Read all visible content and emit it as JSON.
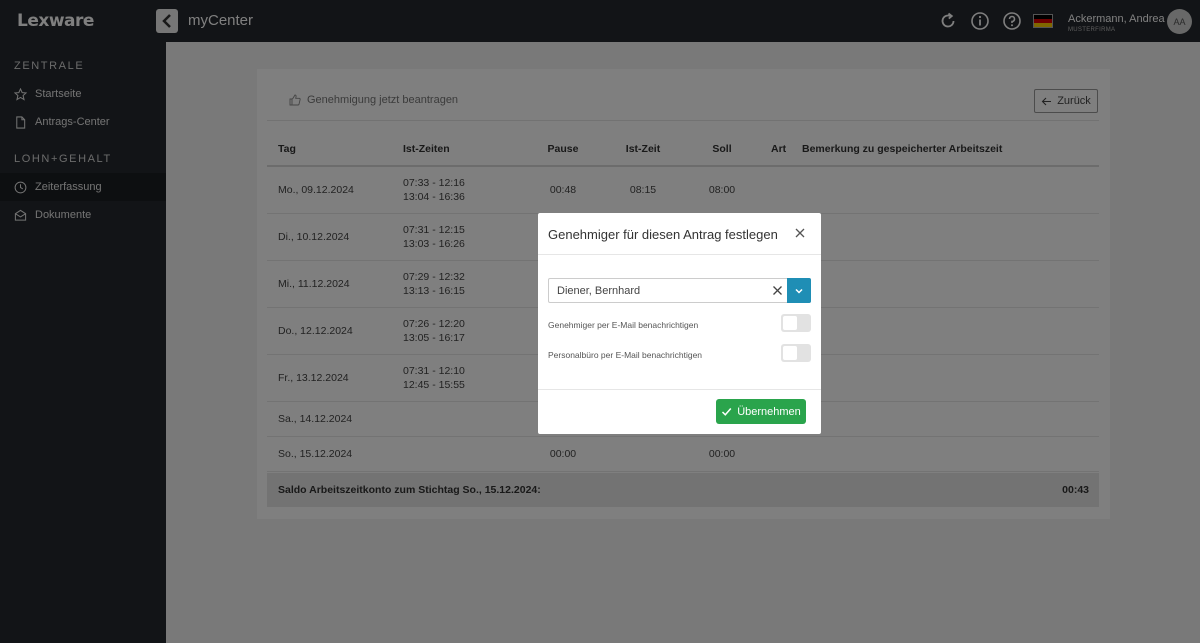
{
  "header": {
    "logo": "Lexware",
    "app_title": "myCenter",
    "user_name": "Ackermann, Andrea",
    "user_company": "MUSTERFIRMA",
    "avatar_initials": "AA"
  },
  "sidebar": {
    "section1": "ZENTRALE",
    "section2": "LOHN+GEHALT",
    "items": [
      {
        "label": "Startseite",
        "icon": "star-icon"
      },
      {
        "label": "Antrags-Center",
        "icon": "document-icon"
      },
      {
        "label": "Zeiterfassung",
        "icon": "clock-icon",
        "active": true
      },
      {
        "label": "Dokumente",
        "icon": "inbox-icon"
      }
    ]
  },
  "toolbar": {
    "request_label": "Genehmigung jetzt beantragen",
    "back_label": "Zurück"
  },
  "table": {
    "headers": [
      "Tag",
      "Ist-Zeiten",
      "Pause",
      "Ist-Zeit",
      "Soll",
      "Art",
      "Bemerkung zu gespeicherter Arbeitszeit"
    ],
    "rows": [
      {
        "tag": "Mo., 09.12.2024",
        "ist1": "07:33 - 12:16",
        "ist2": "13:04 - 16:36",
        "pause": "00:48",
        "istzeit": "08:15",
        "soll": "08:00"
      },
      {
        "tag": "Di., 10.12.2024",
        "ist1": "07:31 - 12:15",
        "ist2": "13:03 - 16:26",
        "pause": "",
        "istzeit": "",
        "soll": ""
      },
      {
        "tag": "Mi., 11.12.2024",
        "ist1": "07:29 - 12:32",
        "ist2": "13:13 - 16:15",
        "pause": "",
        "istzeit": "",
        "soll": ""
      },
      {
        "tag": "Do., 12.12.2024",
        "ist1": "07:26 - 12:20",
        "ist2": "13:05 - 16:17",
        "pause": "",
        "istzeit": "",
        "soll": ""
      },
      {
        "tag": "Fr., 13.12.2024",
        "ist1": "07:31 - 12:10",
        "ist2": "12:45 - 15:55",
        "pause": "",
        "istzeit": "",
        "soll": ""
      },
      {
        "tag": "Sa., 14.12.2024",
        "ist1": "",
        "ist2": "",
        "pause": "",
        "istzeit": "",
        "soll": ""
      },
      {
        "tag": "So., 15.12.2024",
        "ist1": "",
        "ist2": "",
        "pause": "00:00",
        "istzeit": "",
        "soll": "00:00"
      }
    ],
    "saldo_label": "Saldo Arbeitszeitkonto zum Stichtag So., 15.12.2024:",
    "saldo_value": "00:43"
  },
  "modal": {
    "title": "Genehmiger für diesen Antrag festlegen",
    "selected_approver": "Diener, Bernhard",
    "option1_label": "Genehmiger per E-Mail benachrichtigen",
    "option1_on": false,
    "option2_label": "Personalbüro per E-Mail benachrichtigen",
    "option2_on": false,
    "apply_label": "Übernehmen"
  },
  "colors": {
    "topbar": "#25292e",
    "accent_blue": "#1f8eb5",
    "apply_green": "#2aa44c"
  }
}
